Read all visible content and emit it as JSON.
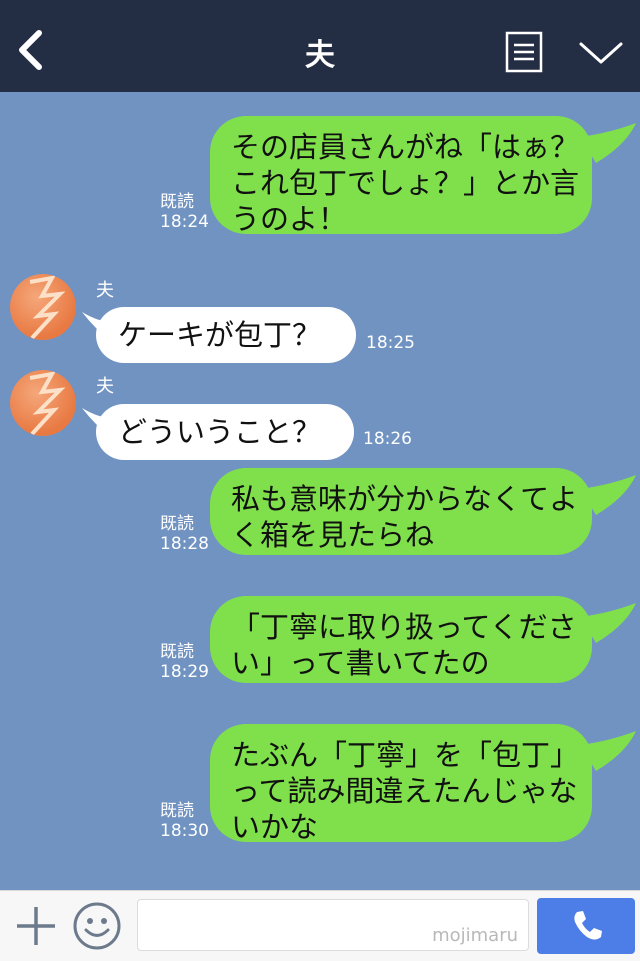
{
  "header": {
    "title": "夫"
  },
  "messages": [
    {
      "side": "me",
      "text": "その店員さんがね「はぁ？これ包丁でしょ？」とか言うのよ！",
      "read": "既読",
      "time": "18:24"
    },
    {
      "side": "them",
      "sender": "夫",
      "text": "ケーキが包丁？",
      "time": "18:25"
    },
    {
      "side": "them",
      "sender": "夫",
      "text": "どういうこと？",
      "time": "18:26"
    },
    {
      "side": "me",
      "text": "私も意味が分からなくてよく箱を見たらね",
      "read": "既読",
      "time": "18:28"
    },
    {
      "side": "me",
      "text": "「丁寧に取り扱ってください」って書いてたの",
      "read": "既読",
      "time": "18:29"
    },
    {
      "side": "me",
      "text": "たぶん「丁寧」を「包丁」って読み間違えたんじゃないかな",
      "read": "既読",
      "time": "18:30"
    }
  ],
  "footer": {
    "watermark": "mojimaru"
  },
  "icons": [
    "back-arrow-icon",
    "menu-icon",
    "chevron-down-icon",
    "plus-icon",
    "smiley-icon",
    "phone-icon"
  ],
  "colors": {
    "header": "#232d44",
    "background": "#7193c2",
    "my_bubble": "#7fe04b",
    "their_bubble": "#ffffff",
    "call_button": "#4d7ee8"
  }
}
